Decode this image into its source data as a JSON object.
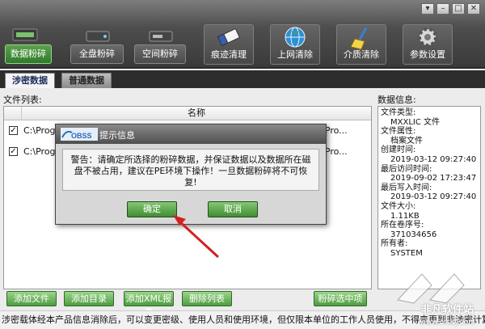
{
  "window": {
    "controls": [
      "▾",
      "–",
      "□",
      "✕"
    ]
  },
  "toolbar": {
    "items": [
      {
        "label": "数据粉碎",
        "icon": "data-shred-icon"
      },
      {
        "label": "全盘粉碎",
        "icon": "full-disk-icon"
      },
      {
        "label": "空间粉碎",
        "icon": "space-shred-icon"
      },
      {
        "label": "痕迹清理",
        "icon": "eraser-icon"
      },
      {
        "label": "上网清除",
        "icon": "internet-globe-icon"
      },
      {
        "label": "介质清除",
        "icon": "broom-icon"
      },
      {
        "label": "参数设置",
        "icon": "gear-icon"
      }
    ]
  },
  "tabs": {
    "secret": "涉密数据",
    "normal": "普通数据"
  },
  "files": {
    "label": "文件列表:",
    "column_name": "名称",
    "rows": [
      {
        "checked": true,
        "path_start": "C:\\Program",
        "path_end": "ojectPro..."
      },
      {
        "checked": true,
        "path_start": "C:\\Program",
        "path_end": "ojectPro..."
      }
    ]
  },
  "info": {
    "label": "数据信息:",
    "lines": [
      {
        "k": "文件类型:",
        "v": "MXXLIC 文件"
      },
      {
        "k": "文件属性:",
        "v": "档案文件"
      },
      {
        "k": "创建时间:",
        "v": "2019-03-12 09:27:40"
      },
      {
        "k": "最后访问时间:",
        "v": "2019-09-02 17:23:47"
      },
      {
        "k": "最后写入时间:",
        "v": "2019-03-12 09:27:40"
      },
      {
        "k": "文件大小:",
        "v": "1.11KB"
      },
      {
        "k": "所在卷序号:",
        "v": "371034656"
      },
      {
        "k": "所有者:",
        "v": "SYSTEM"
      }
    ]
  },
  "buttons": {
    "add_file": "添加文件",
    "add_dir": "添加目录",
    "add_xml": "添加XML报表",
    "del_list": "删除列表",
    "shred_selected": "粉碎选中项"
  },
  "footer": {
    "text": "涉密载体经本产品信息消除后，可以变更密级、使用人员和使用环境，但仅限本单位的工作人员使用，不得变更到非涉密计算机使用。"
  },
  "dialog": {
    "logo_text": "OBSS",
    "title": "提示信息",
    "message": "警告：请确定所选择的粉碎数据，并保证数据以及数据所在磁盘不被占用，建议在PE环境下操作！一旦数据粉碎将不可恢复!",
    "ok": "确定",
    "cancel": "取消"
  },
  "watermark": {
    "title": "非凡软件站",
    "url": "www.crsky.com"
  },
  "colors": {
    "accent_green": "#4e9c40",
    "arrow_red": "#d32020"
  }
}
